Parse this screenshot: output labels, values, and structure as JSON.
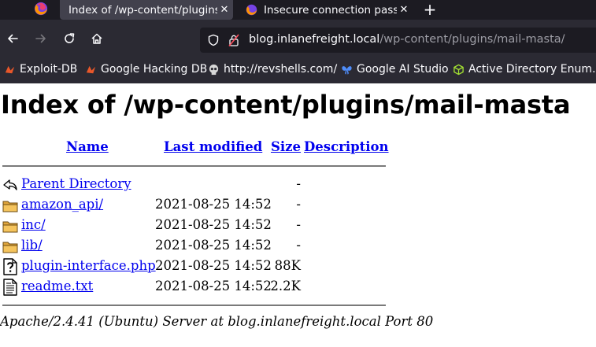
{
  "browser": {
    "tabs": [
      {
        "title": "Index of /wp-content/plugins/mail-masta",
        "active": true
      },
      {
        "title": "Insecure connection password warning",
        "active": false
      }
    ],
    "new_tab_label": "+",
    "address": {
      "host": "blog.inlanefreight.local",
      "path": "/wp-content/plugins/mail-masta/"
    },
    "bookmarks": [
      "Exploit-DB",
      "Google Hacking DB",
      "http://revshells.com/",
      "Google AI Studio",
      "Active Directory Enum…"
    ]
  },
  "page": {
    "heading": "Index of /wp-content/plugins/mail-masta",
    "columns": {
      "name": "Name",
      "modified": "Last modified",
      "size": "Size",
      "description": "Description"
    },
    "rows": [
      {
        "icon": "back-icon",
        "name": "Parent Directory",
        "modified": "",
        "size": "-"
      },
      {
        "icon": "folder-icon",
        "name": "amazon_api/",
        "modified": "2021-08-25 14:52",
        "size": "-"
      },
      {
        "icon": "folder-icon",
        "name": "inc/",
        "modified": "2021-08-25 14:52",
        "size": "-"
      },
      {
        "icon": "folder-icon",
        "name": "lib/",
        "modified": "2021-08-25 14:52",
        "size": "-"
      },
      {
        "icon": "unknown-file-icon",
        "name": "plugin-interface.php",
        "modified": "2021-08-25 14:52",
        "size": "88K"
      },
      {
        "icon": "text-file-icon",
        "name": "readme.txt",
        "modified": "2021-08-25 14:52",
        "size": "2.2K"
      }
    ],
    "footer": "Apache/2.4.41 (Ubuntu) Server at blog.inlanefreight.local Port 80"
  },
  "colors": {
    "link": "#0000ee",
    "chrome_dark": "#1c1b22",
    "chrome": "#2b2a33",
    "tab_active": "#42414d"
  }
}
